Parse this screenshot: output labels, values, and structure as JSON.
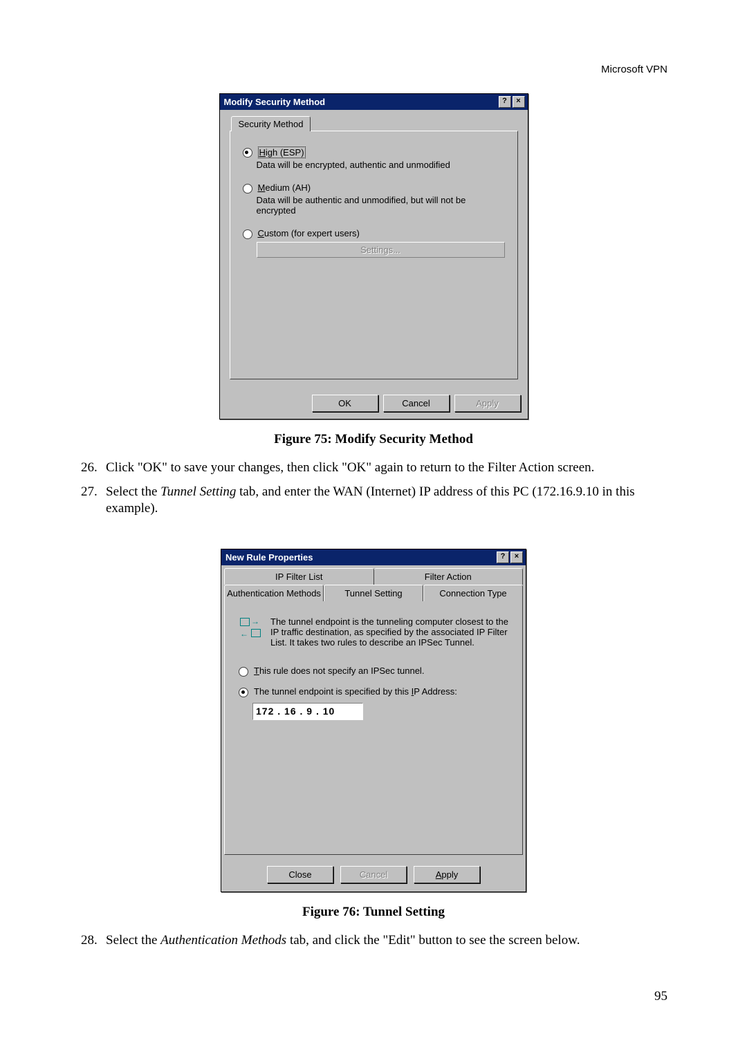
{
  "header": {
    "right": "Microsoft VPN"
  },
  "page_number": "95",
  "dialog1": {
    "title": "Modify Security Method",
    "tab": "Security Method",
    "options": {
      "high": {
        "label_prefix": "H",
        "label_rest": "igh (ESP)",
        "desc": "Data will be encrypted, authentic and unmodified"
      },
      "medium": {
        "label_prefix": "M",
        "label_rest": "edium (AH)",
        "desc": "Data will be authentic and unmodified, but will not be encrypted"
      },
      "custom": {
        "label_prefix": "C",
        "label_rest": "ustom (for expert users)",
        "settings_btn": "Settings..."
      }
    },
    "buttons": {
      "ok": "OK",
      "cancel": "Cancel",
      "apply": "Apply"
    }
  },
  "figure75": "Figure 75: Modify Security Method",
  "step26": {
    "num": "26.",
    "text": "Click \"OK\" to save your changes, then click \"OK\" again to return to the Filter Action screen."
  },
  "step27": {
    "num": "27.",
    "text_a": "Select the ",
    "text_em": "Tunnel Setting",
    "text_b": " tab, and enter the WAN (Internet) IP address of this PC (172.16.9.10 in this example)."
  },
  "dialog2": {
    "title": "New Rule Properties",
    "tabs_row1": {
      "a": "IP Filter List",
      "b": "Filter Action"
    },
    "tabs_row2": {
      "a": "Authentication Methods",
      "b": "Tunnel Setting",
      "c": "Connection Type"
    },
    "desc": "The tunnel endpoint is the tunneling computer closest to the IP traffic destination, as specified by the associated IP Filter List. It takes two rules to describe an IPSec Tunnel.",
    "opt_no": {
      "prefix": "T",
      "rest": "his rule does not specify an IPSec tunnel."
    },
    "opt_yes": {
      "text_a": "The tunnel endpoint is specified by this ",
      "prefix": "I",
      "text_b": "P Address:"
    },
    "ip": "172 . 16  .  9   . 10",
    "buttons": {
      "close": "Close",
      "cancel": "Cancel",
      "apply_prefix": "A",
      "apply_rest": "pply"
    }
  },
  "figure76": "Figure 76: Tunnel Setting",
  "step28": {
    "num": "28.",
    "text_a": "Select the ",
    "text_em": "Authentication Methods",
    "text_b": " tab, and click the \"Edit\" button to see the screen below."
  }
}
